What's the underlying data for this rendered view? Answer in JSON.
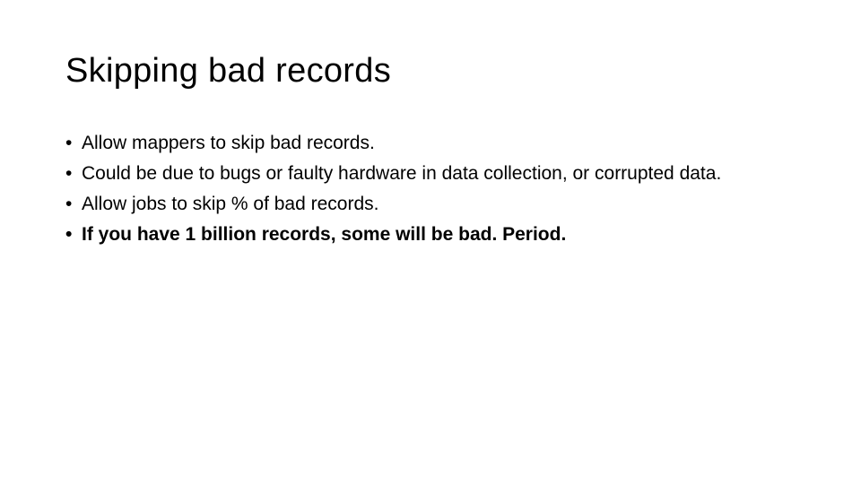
{
  "slide": {
    "title": "Skipping bad records",
    "bullets": [
      {
        "text": "Allow mappers to skip bad records.",
        "bold": false
      },
      {
        "text": "Could be due to bugs or faulty hardware in data collection, or corrupted data.",
        "bold": false
      },
      {
        "text": "Allow jobs to skip % of bad records.",
        "bold": false
      },
      {
        "text": "If you have 1 billion records, some will be bad. Period.",
        "bold": true
      }
    ],
    "bullet_glyph": "•"
  }
}
